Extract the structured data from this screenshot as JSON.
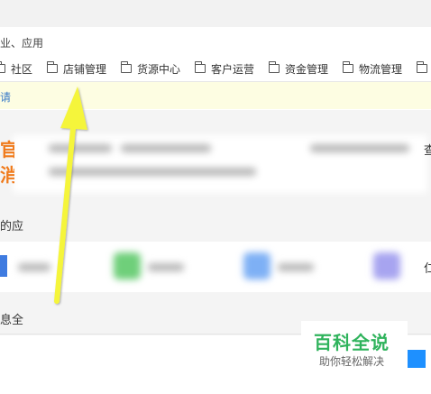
{
  "address_bar": {
    "text": "业、应用"
  },
  "bookmarks": [
    {
      "label": "社区",
      "icon": "folder-icon"
    },
    {
      "label": "店铺管理",
      "icon": "folder-icon"
    },
    {
      "label": "货源中心",
      "icon": "folder-icon"
    },
    {
      "label": "客户运营",
      "icon": "folder-icon"
    },
    {
      "label": "资金管理",
      "icon": "folder-icon"
    },
    {
      "label": "物流管理",
      "icon": "folder-icon"
    }
  ],
  "notice": {
    "text": "请"
  },
  "content": {
    "orange_top": "官方",
    "orange_bottom": "消息",
    "section_label": "的应",
    "info_label": "息全",
    "right_char_top": "查",
    "right_char_mid": "仁"
  },
  "watermark": {
    "title": "百科全说",
    "subtitle": "助你轻松解决"
  },
  "colors": {
    "accent_blue": "#3a7bc8",
    "notice_bg": "#fdfde2",
    "arrow": "#f5f53a",
    "watermark_green": "#2fb35c",
    "orange": "#f07a1a"
  }
}
